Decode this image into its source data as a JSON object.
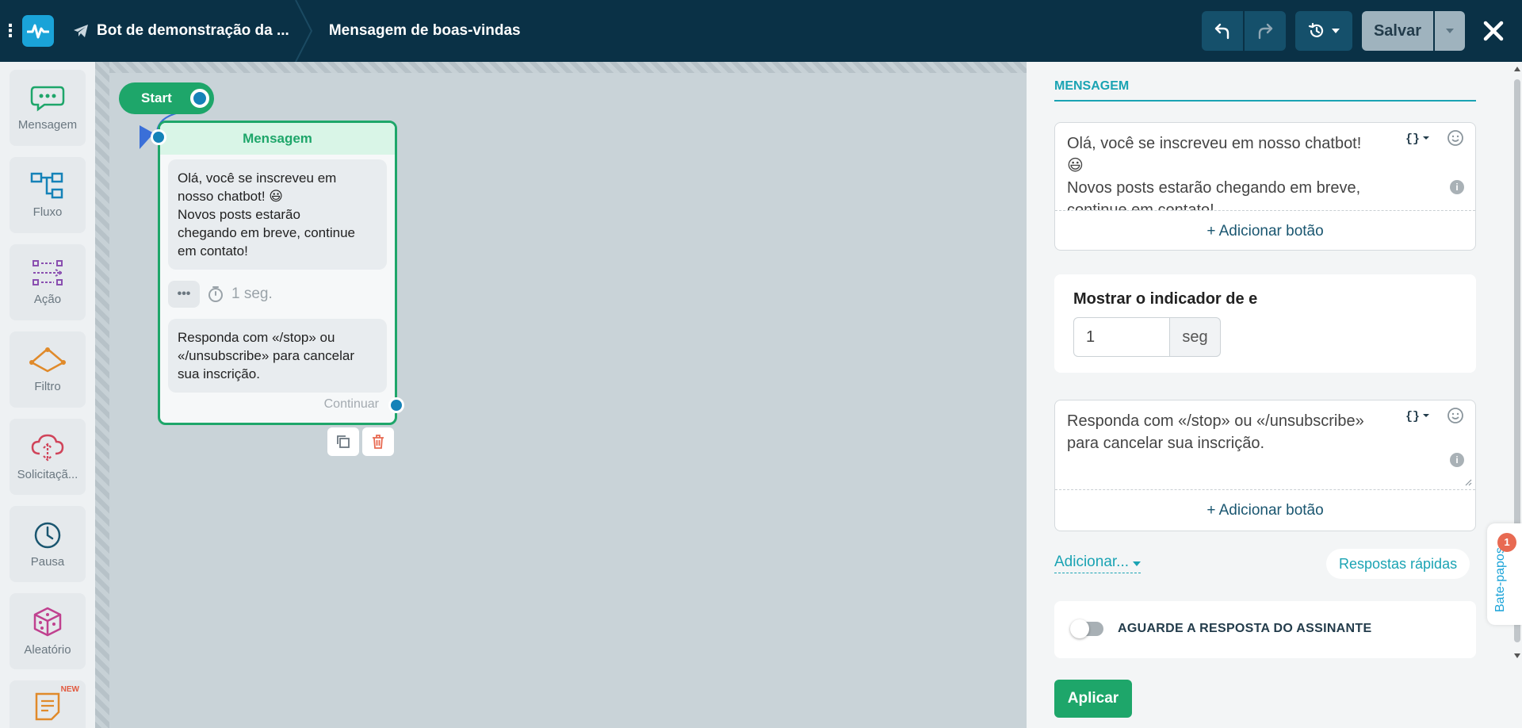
{
  "header": {
    "bot_name": "Bot de demonstração da ...",
    "current_step": "Mensagem de boas-vindas",
    "save_label": "Salvar"
  },
  "sidebar": {
    "items": [
      {
        "label": "Mensagem",
        "icon": "chat-bubble-icon",
        "color": "#1ea66a"
      },
      {
        "label": "Fluxo",
        "icon": "flow-icon",
        "color": "#1582b8"
      },
      {
        "label": "Ação",
        "icon": "action-icon",
        "color": "#8a4fb0"
      },
      {
        "label": "Filtro",
        "icon": "filter-icon",
        "color": "#e08a2a"
      },
      {
        "label": "Solicitaçã...",
        "icon": "cloud-request-icon",
        "color": "#d0445a"
      },
      {
        "label": "Pausa",
        "icon": "clock-icon",
        "color": "#1a5670"
      },
      {
        "label": "Aleatório",
        "icon": "dice-icon",
        "color": "#c0418f"
      },
      {
        "label": "",
        "icon": "note-icon",
        "color": "#e08a2a",
        "badge": "NEW"
      }
    ]
  },
  "canvas": {
    "start_label": "Start",
    "node": {
      "title": "Mensagem",
      "message1_line1": "Olá, você se inscreveu em",
      "message1_line2": "nosso chatbot! 😃",
      "message1_line3": "Novos posts estarão",
      "message1_line4": "chegando em breve, continue",
      "message1_line5": "em contato!",
      "delay_text": "1 seg.",
      "message2_line1": "Responda com «/stop» ou",
      "message2_line2": "«/unsubscribe» para cancelar",
      "message2_line3": "sua inscrição.",
      "continue_label": "Continuar"
    }
  },
  "panel": {
    "title": "MENSAGEM",
    "message1": {
      "line1": "Olá, você se inscreveu em nosso chatbot!",
      "line2": "😃",
      "line3": "Novos posts estarão chegando em breve,",
      "line4": "continue em contato!"
    },
    "add_button_label": "+ Adicionar botão",
    "typing_title": "Mostrar o indicador de e",
    "typing_value": "1",
    "typing_unit": "seg",
    "message2": {
      "line1": "Responda com «/stop» ou «/unsubscribe»",
      "line2": "para cancelar sua inscrição."
    },
    "add_more_label": "Adicionar...",
    "quick_replies_label": "Respostas rápidas",
    "wait_label": "AGUARDE A RESPOSTA DO ASSINANTE",
    "apply_label": "Aplicar"
  },
  "chat_tab": {
    "label": "Bate-papos",
    "badge": "1"
  }
}
